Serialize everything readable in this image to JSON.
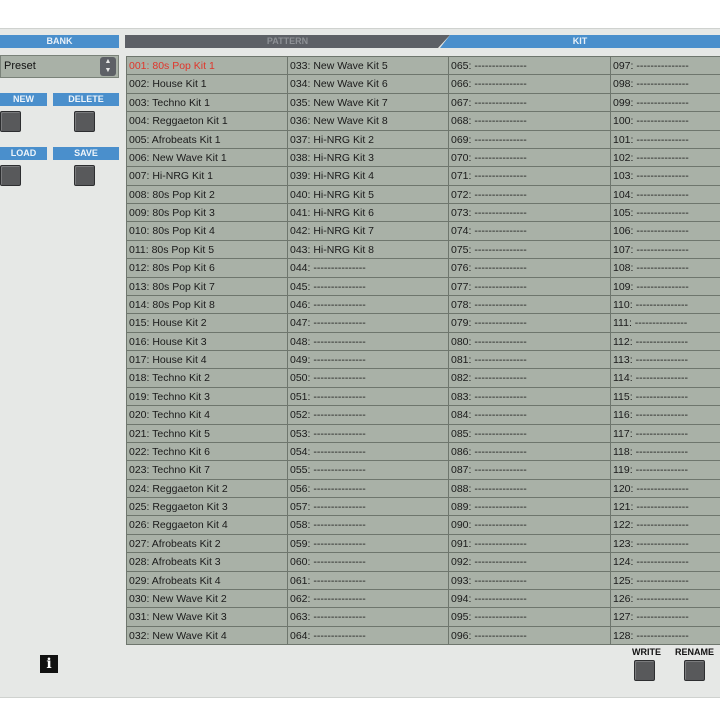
{
  "headers": {
    "bank": "BANK",
    "pattern": "PATTERN",
    "kit": "KIT"
  },
  "bank": {
    "preset_label": "Preset",
    "new_label": "NEW",
    "delete_label": "DELETE",
    "load_label": "LOAD",
    "save_label": "SAVE"
  },
  "footer": {
    "write_label": "WRITE",
    "rename_label": "RENAME",
    "info_glyph": "i"
  },
  "kits": {
    "selected_index": 0,
    "columns": [
      [
        "001: 80s Pop Kit 1",
        "002: House Kit 1",
        "003: Techno Kit 1",
        "004: Reggaeton Kit 1",
        "005: Afrobeats Kit 1",
        "006: New Wave Kit 1",
        "007: Hi-NRG Kit 1",
        "008: 80s Pop Kit 2",
        "009: 80s Pop Kit 3",
        "010: 80s Pop Kit 4",
        "011: 80s Pop Kit 5",
        "012: 80s Pop Kit 6",
        "013: 80s Pop Kit 7",
        "014: 80s Pop Kit 8",
        "015: House Kit 2",
        "016: House Kit 3",
        "017: House Kit 4",
        "018: Techno Kit 2",
        "019: Techno Kit 3",
        "020: Techno Kit 4",
        "021: Techno Kit 5",
        "022: Techno Kit 6",
        "023: Techno Kit 7",
        "024: Reggaeton Kit 2",
        "025: Reggaeton Kit 3",
        "026: Reggaeton Kit 4",
        "027: Afrobeats Kit 2",
        "028: Afrobeats Kit 3",
        "029: Afrobeats Kit 4",
        "030: New Wave Kit 2",
        "031: New Wave Kit 3",
        "032: New Wave Kit 4"
      ],
      [
        "033: New Wave Kit 5",
        "034: New Wave Kit 6",
        "035: New Wave Kit 7",
        "036: New Wave Kit 8",
        "037: Hi-NRG Kit 2",
        "038: Hi-NRG Kit 3",
        "039: Hi-NRG Kit 4",
        "040: Hi-NRG Kit 5",
        "041: Hi-NRG Kit 6",
        "042: Hi-NRG Kit 7",
        "043: Hi-NRG Kit 8",
        "044: ---------------",
        "045: ---------------",
        "046: ---------------",
        "047: ---------------",
        "048: ---------------",
        "049: ---------------",
        "050: ---------------",
        "051: ---------------",
        "052: ---------------",
        "053: ---------------",
        "054: ---------------",
        "055: ---------------",
        "056: ---------------",
        "057: ---------------",
        "058: ---------------",
        "059: ---------------",
        "060: ---------------",
        "061: ---------------",
        "062: ---------------",
        "063: ---------------",
        "064: ---------------"
      ],
      [
        "065: ---------------",
        "066: ---------------",
        "067: ---------------",
        "068: ---------------",
        "069: ---------------",
        "070: ---------------",
        "071: ---------------",
        "072: ---------------",
        "073: ---------------",
        "074: ---------------",
        "075: ---------------",
        "076: ---------------",
        "077: ---------------",
        "078: ---------------",
        "079: ---------------",
        "080: ---------------",
        "081: ---------------",
        "082: ---------------",
        "083: ---------------",
        "084: ---------------",
        "085: ---------------",
        "086: ---------------",
        "087: ---------------",
        "088: ---------------",
        "089: ---------------",
        "090: ---------------",
        "091: ---------------",
        "092: ---------------",
        "093: ---------------",
        "094: ---------------",
        "095: ---------------",
        "096: ---------------"
      ],
      [
        "097: ---------------",
        "098: ---------------",
        "099: ---------------",
        "100: ---------------",
        "101: ---------------",
        "102: ---------------",
        "103: ---------------",
        "104: ---------------",
        "105: ---------------",
        "106: ---------------",
        "107: ---------------",
        "108: ---------------",
        "109: ---------------",
        "110: ---------------",
        "111: ---------------",
        "112: ---------------",
        "113: ---------------",
        "114: ---------------",
        "115: ---------------",
        "116: ---------------",
        "117: ---------------",
        "118: ---------------",
        "119: ---------------",
        "120: ---------------",
        "121: ---------------",
        "122: ---------------",
        "123: ---------------",
        "124: ---------------",
        "125: ---------------",
        "126: ---------------",
        "127: ---------------",
        "128: ---------------"
      ]
    ]
  }
}
